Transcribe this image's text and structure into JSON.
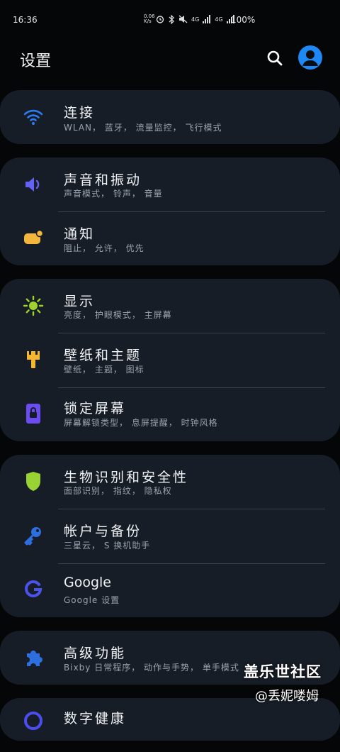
{
  "status_bar": {
    "time": "16:36",
    "net_speed": "0.06 K/s",
    "network1": "4G",
    "network2": "4G",
    "battery": "100%"
  },
  "header": {
    "title": "设置"
  },
  "cards": [
    {
      "items": [
        {
          "label": "连接",
          "sub": "WLAN， 蓝牙， 流量监控， 飞行模式",
          "icon": "wifi-icon",
          "color": "#2f7bf1"
        }
      ]
    },
    {
      "items": [
        {
          "label": "声音和振动",
          "sub": "声音模式， 铃声， 音量",
          "icon": "volume-icon",
          "color": "#6461f5"
        },
        {
          "label": "通知",
          "sub": "阻止， 允许， 优先",
          "icon": "notification-icon",
          "color": "#f5b63c"
        }
      ]
    },
    {
      "items": [
        {
          "label": "显示",
          "sub": "亮度， 护眼模式， 主屏幕",
          "icon": "brightness-icon",
          "color": "#9fd22b"
        },
        {
          "label": "壁纸和主题",
          "sub": "壁纸， 主题， 图标",
          "icon": "brush-icon",
          "color": "#f5b630"
        },
        {
          "label": "锁定屏幕",
          "sub": "屏幕解锁类型， 息屏提醒， 时钟风格",
          "icon": "lock-icon",
          "color": "#6a4cf0"
        }
      ]
    },
    {
      "items": [
        {
          "label": "生物识别和安全性",
          "sub": "面部识别， 指纹， 隐私权",
          "icon": "shield-icon",
          "color": "#98d233"
        },
        {
          "label": "帐户与备份",
          "sub": "三星云， S 换机助手",
          "icon": "key-icon",
          "color": "#2e6fe0"
        },
        {
          "label": "Google",
          "sub": "Google 设置",
          "icon": "google-icon",
          "color": "#4a54ea"
        }
      ]
    },
    {
      "items": [
        {
          "label": "高级功能",
          "sub": "Bixby 日常程序， 动作与手势， 单手模式",
          "icon": "puzzle-icon",
          "color": "#2e6fe0"
        },
        {
          "label": "数字健康",
          "sub": "",
          "icon": "wellbeing-icon",
          "color": "#4a4ef0"
        }
      ]
    }
  ],
  "watermark": {
    "line1": "盖乐世社区",
    "line2": "@丢妮喽姆"
  }
}
